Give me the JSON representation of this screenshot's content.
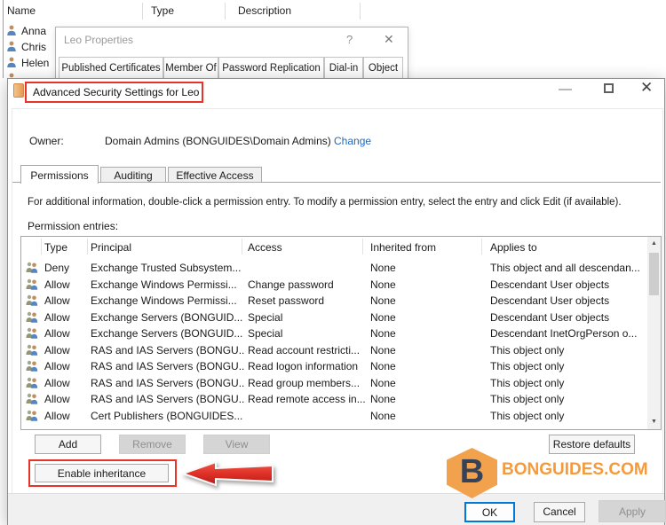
{
  "background_window": {
    "columns": [
      "Name",
      "Type",
      "Description"
    ],
    "users": [
      "Anna",
      "Chris",
      "Helen"
    ]
  },
  "properties_dialog": {
    "title": "Leo Properties",
    "help_glyph": "?",
    "close_glyph": "✕",
    "tabs": [
      "Published Certificates",
      "Member Of",
      "Password Replication",
      "Dial-in",
      "Object"
    ]
  },
  "dialog": {
    "title": "Advanced Security Settings for Leo",
    "controls": {
      "close": "✕"
    },
    "owner_label": "Owner:",
    "owner_value": "Domain Admins (BONGUIDES\\Domain Admins)",
    "change_link": "Change",
    "tabs": [
      "Permissions",
      "Auditing",
      "Effective Access"
    ],
    "instruction": "For additional information, double-click a permission entry. To modify a permission entry, select the entry and click Edit (if available).",
    "entries_label": "Permission entries:",
    "table": {
      "headers": [
        "Type",
        "Principal",
        "Access",
        "Inherited from",
        "Applies to"
      ],
      "rows": [
        {
          "type": "Deny",
          "principal": "Exchange Trusted Subsystem...",
          "access": "",
          "inherited": "None",
          "applies": "This object and all descendan..."
        },
        {
          "type": "Allow",
          "principal": "Exchange Windows Permissi...",
          "access": "Change password",
          "inherited": "None",
          "applies": "Descendant User objects"
        },
        {
          "type": "Allow",
          "principal": "Exchange Windows Permissi...",
          "access": "Reset password",
          "inherited": "None",
          "applies": "Descendant User objects"
        },
        {
          "type": "Allow",
          "principal": "Exchange Servers (BONGUID...",
          "access": "Special",
          "inherited": "None",
          "applies": "Descendant User objects"
        },
        {
          "type": "Allow",
          "principal": "Exchange Servers (BONGUID...",
          "access": "Special",
          "inherited": "None",
          "applies": "Descendant InetOrgPerson o..."
        },
        {
          "type": "Allow",
          "principal": "RAS and IAS Servers (BONGU...",
          "access": "Read account restricti...",
          "inherited": "None",
          "applies": "This object only"
        },
        {
          "type": "Allow",
          "principal": "RAS and IAS Servers (BONGU...",
          "access": "Read logon information",
          "inherited": "None",
          "applies": "This object only"
        },
        {
          "type": "Allow",
          "principal": "RAS and IAS Servers (BONGU...",
          "access": "Read group members...",
          "inherited": "None",
          "applies": "This object only"
        },
        {
          "type": "Allow",
          "principal": "RAS and IAS Servers (BONGU...",
          "access": "Read remote access in...",
          "inherited": "None",
          "applies": "This object only"
        },
        {
          "type": "Allow",
          "principal": "Cert Publishers (BONGUIDES...",
          "access": "",
          "inherited": "None",
          "applies": "This object only"
        }
      ]
    },
    "scrollbar": {
      "up": "▲",
      "down": "▼"
    },
    "buttons": {
      "add": "Add",
      "remove": "Remove",
      "view": "View",
      "restore": "Restore defaults",
      "enable_inheritance": "Enable inheritance",
      "ok": "OK",
      "cancel": "Cancel",
      "apply": "Apply"
    }
  },
  "branding": {
    "letter": "B",
    "text": "BONGUIDES.COM"
  },
  "colors": {
    "annotation_red": "#e8332a",
    "link_blue": "#1c68c5",
    "ok_border_blue": "#0078d7",
    "brand_orange": "#f39b3d",
    "brand_navy": "#364257"
  }
}
